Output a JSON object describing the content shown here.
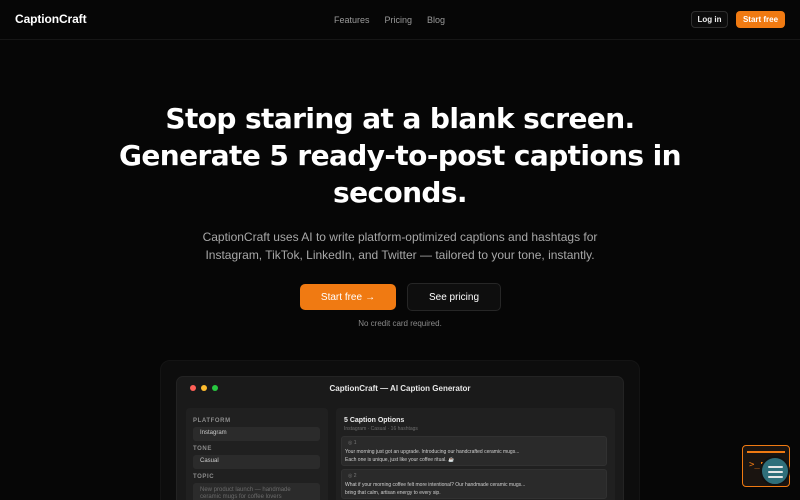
{
  "nav": {
    "logo": "CaptionCraft",
    "links": [
      "Features",
      "Pricing",
      "Blog"
    ],
    "login_label": "Log in",
    "start_label": "Start free"
  },
  "hero": {
    "title_lines": [
      "Stop staring at a blank screen.",
      "Generate 5 ready-to-post captions in",
      "seconds."
    ],
    "subtitle_lines": [
      "CaptionCraft uses AI to write platform-optimized captions and hashtags for",
      "Instagram, TikTok, LinkedIn, and Twitter — tailored to your tone, instantly."
    ],
    "cta_primary": "Start free",
    "cta_primary_arrow": "→",
    "cta_secondary": "See pricing",
    "note": "No credit card required."
  },
  "preview": {
    "window_title": "CaptionCraft — AI Caption Generator",
    "platform_label": "PLATFORM",
    "platform_value": "Instagram",
    "tone_label": "TONE",
    "tone_value": "Casual",
    "topic_label": "TOPIC",
    "topic_placeholder": "New product launch — handmade ceramic mugs for coffee lovers",
    "results_title": "5 Caption Options",
    "results_meta": "Instagram · Casual · 16 hashtags",
    "captions": [
      {
        "num": "1",
        "line1": "Your morning just got an upgrade. Introducing our handcrafted ceramic mugs...",
        "line2": "Each one is unique, just like your coffee ritual. ☕"
      },
      {
        "num": "2",
        "line1": "What if your morning coffee felt more intentional? Our handmade ceramic mugs...",
        "line2": "bring that calm, artisan energy to every sip."
      }
    ]
  },
  "colors": {
    "accent": "#f07a12",
    "background": "#060606"
  }
}
